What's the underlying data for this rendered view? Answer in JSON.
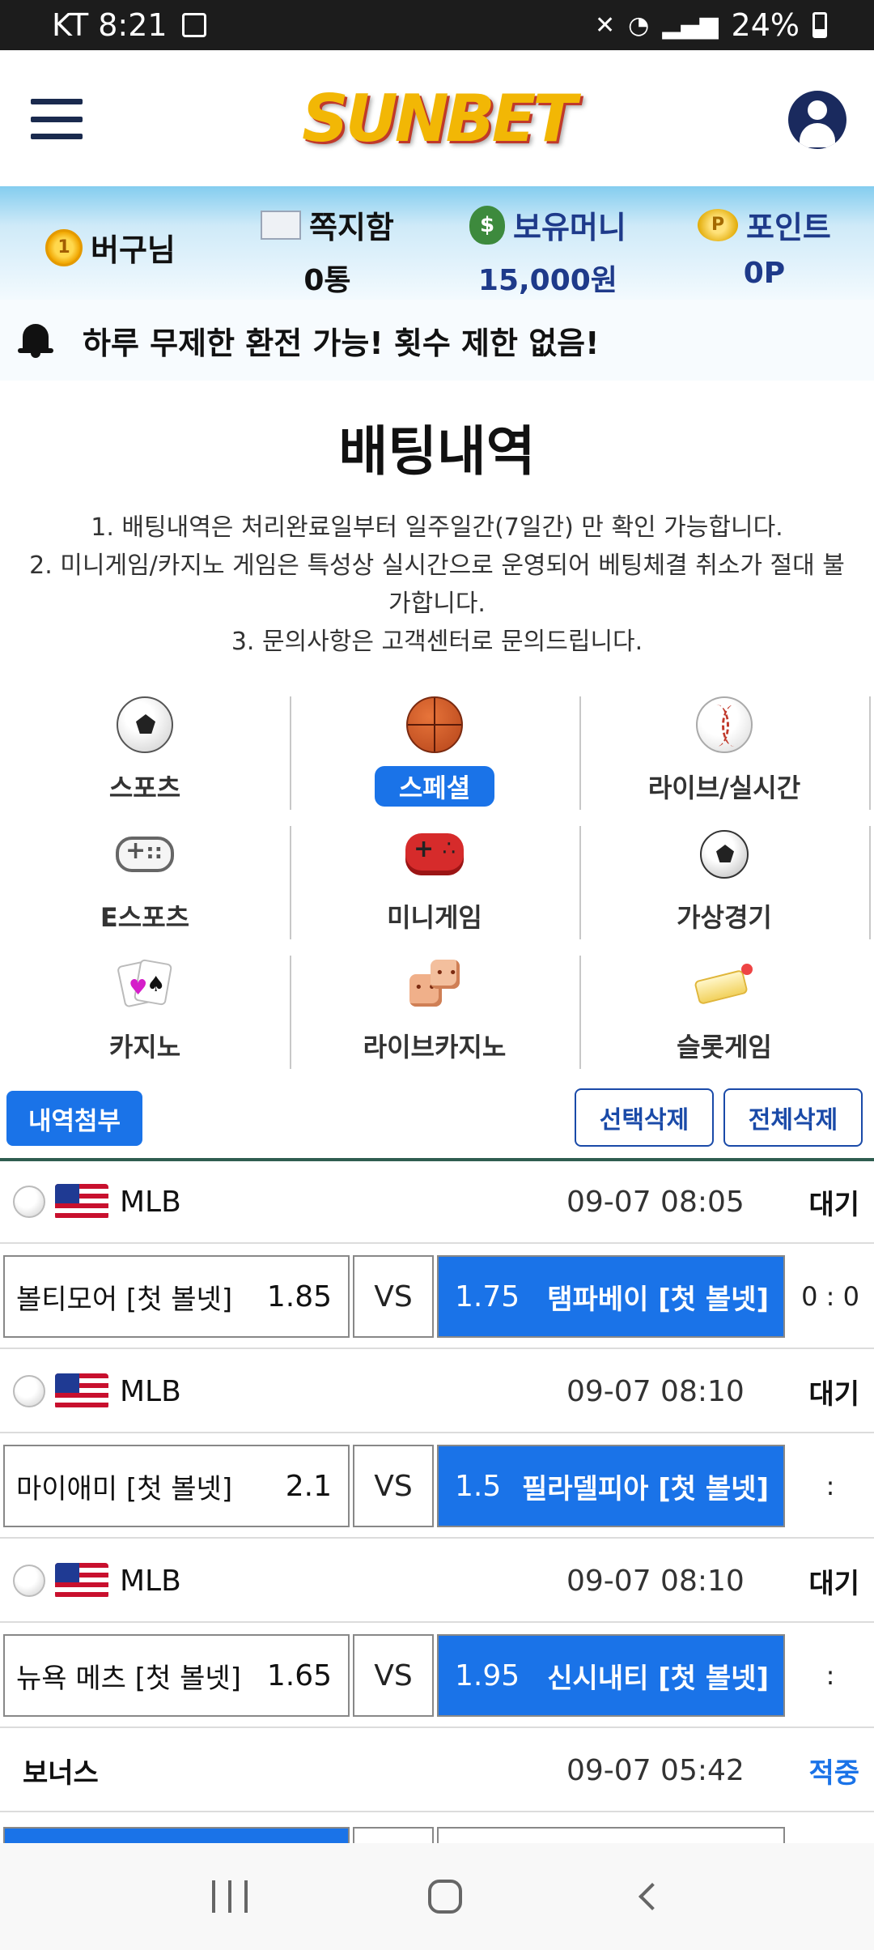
{
  "status_bar": {
    "carrier_time": "KT 8:21",
    "battery": "24%"
  },
  "header": {
    "logo_text": "SUNBET"
  },
  "info_bar": {
    "user_name": "버구님",
    "messages": {
      "label": "쪽지함",
      "value": "0통"
    },
    "money": {
      "label": "보유머니",
      "value": "15,000원"
    },
    "points": {
      "label": "포인트",
      "value": "0P"
    }
  },
  "notice": {
    "text": "하루 무제한 환전 가능! 횟수 제한 없음!"
  },
  "page": {
    "title": "배팅내역",
    "rules": [
      "1. 배팅내역은 처리완료일부터 일주일간(7일간) 만 확인 가능합니다.",
      "2. 미니게임/카지노 게임은 특성상 실시간으로 운영되어 베팅체결 취소가 절대 불가합니다.",
      "3. 문의사항은 고객센터로 문의드립니다."
    ]
  },
  "categories": [
    {
      "label": "스포츠",
      "icon": "soccer-ball-icon",
      "active": false
    },
    {
      "label": "스페셜",
      "icon": "basketball-icon",
      "active": true
    },
    {
      "label": "라이브/실시간",
      "icon": "baseball-icon",
      "active": false
    },
    {
      "label": "E스포츠",
      "icon": "gamepad-icon",
      "active": false
    },
    {
      "label": "미니게임",
      "icon": "red-gamepad-icon",
      "active": false
    },
    {
      "label": "가상경기",
      "icon": "virtual-soccer-icon",
      "active": false
    },
    {
      "label": "카지노",
      "icon": "cards-icon",
      "active": false
    },
    {
      "label": "라이브카지노",
      "icon": "dice-icon",
      "active": false
    },
    {
      "label": "슬롯게임",
      "icon": "slot-icon",
      "active": false
    }
  ],
  "actions": {
    "attach": "내역첨부",
    "delete_selected": "선택삭제",
    "delete_all": "전체삭제"
  },
  "bets": [
    {
      "league": "MLB",
      "datetime": "09-07 08:05",
      "status": "대기",
      "home": "볼티모어 [첫 볼넷]",
      "home_odds": "1.85",
      "vs": "VS",
      "away_odds": "1.75",
      "away": "탬파베이 [첫 볼넷]",
      "score": "0 : 0"
    },
    {
      "league": "MLB",
      "datetime": "09-07 08:10",
      "status": "대기",
      "home": "마이애미 [첫 볼넷]",
      "home_odds": "2.1",
      "vs": "VS",
      "away_odds": "1.5",
      "away": "필라델피아 [첫 볼넷]",
      "score": ":"
    },
    {
      "league": "MLB",
      "datetime": "09-07 08:10",
      "status": "대기",
      "home": "뉴욕 메츠 [첫 볼넷]",
      "home_odds": "1.65",
      "vs": "VS",
      "away_odds": "1.95",
      "away": "신시내티 [첫 볼넷]",
      "score": ":"
    }
  ],
  "bonus": {
    "label": "보너스",
    "datetime": "09-07 05:42",
    "status": "적중"
  },
  "colors": {
    "accent": "#1a73e8",
    "navy": "#1e3a8a",
    "sky": "#84cdef"
  }
}
